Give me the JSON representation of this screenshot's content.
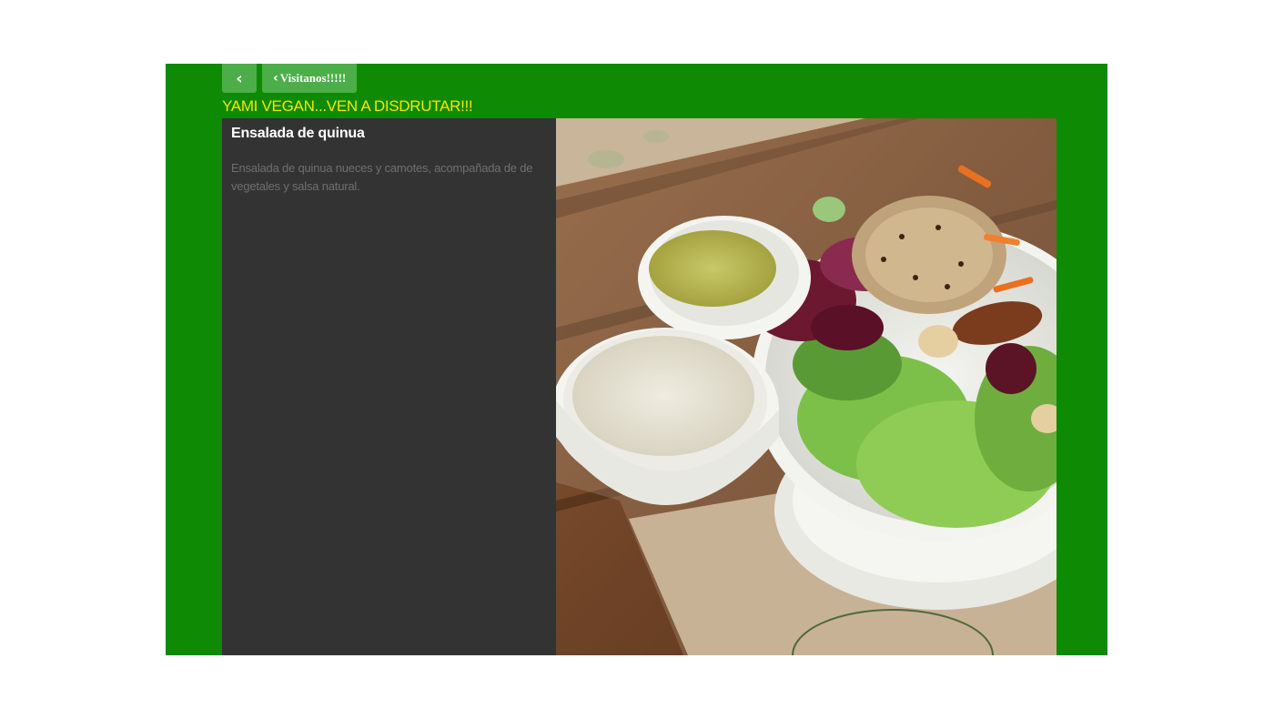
{
  "nav": {
    "back_icon": "chevron-left-icon",
    "back_glyph": "‹",
    "visit_label": "Visitanos!!!!!",
    "visit_icon_glyph": "‹"
  },
  "header": {
    "title": "YAMI VEGAN...VEN A DISDRUTAR!!!"
  },
  "item": {
    "name": "Ensalada de quinua",
    "description": "Ensalada de quinua nueces y camotes, acompañada de de vegetales y salsa natural."
  },
  "colors": {
    "background": "#0e8a05",
    "button": "#4cae49",
    "title": "#f2e600",
    "panel": "#333333"
  }
}
